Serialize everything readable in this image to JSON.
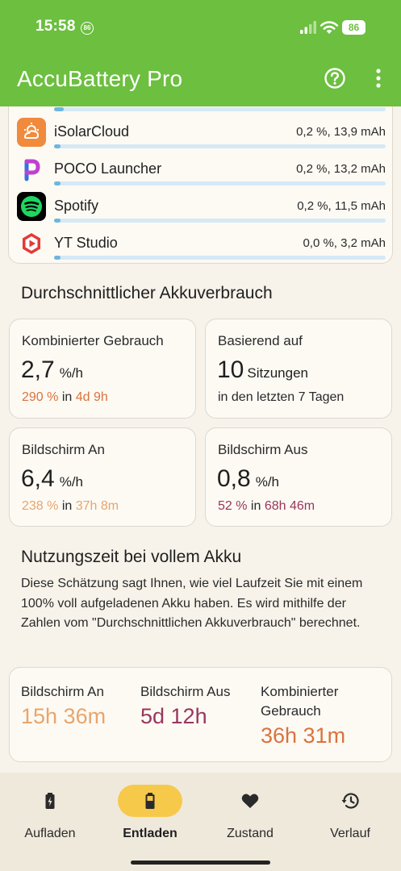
{
  "status_bar": {
    "time": "15:58",
    "notification_badge": "86",
    "battery_level": "86"
  },
  "app_bar": {
    "title": "AccuBattery Pro",
    "help_icon": "help-circle-icon",
    "more_icon": "more-vert-icon"
  },
  "app_usage": [
    {
      "name": "iSolarCloud",
      "value": "0,2 %, 13,9 mAh",
      "bar_fraction": 0.02,
      "icon": "isolarcloud-icon",
      "color": "#f08a3c"
    },
    {
      "name": "POCO Launcher",
      "value": "0,2 %, 13,2 mAh",
      "bar_fraction": 0.02,
      "icon": "poco-launcher-icon",
      "color": "#3b6fe0"
    },
    {
      "name": "Spotify",
      "value": "0,2 %, 11,5 mAh",
      "bar_fraction": 0.02,
      "icon": "spotify-icon",
      "color": "#1ed760"
    },
    {
      "name": "YT Studio",
      "value": "0,0 %, 3,2 mAh",
      "bar_fraction": 0.01,
      "icon": "yt-studio-icon",
      "color": "#e53935"
    }
  ],
  "average_usage": {
    "title": "Durchschnittlicher Akkuverbrauch",
    "combined": {
      "label": "Kombinierter Gebrauch",
      "value": "2,7",
      "unit": "%/h",
      "sub_value": "290 %",
      "sub_in": "in",
      "sub_time": "4d 9h"
    },
    "based_on": {
      "label": "Basierend auf",
      "value": "10",
      "unit": "Sitzungen",
      "sub_prefix": "in den letzten",
      "sub_count": "7",
      "sub_suffix": "Tagen"
    },
    "screen_on": {
      "label": "Bildschirm An",
      "value": "6,4",
      "unit": "%/h",
      "sub_value": "238 %",
      "sub_in": "in",
      "sub_time": "37h 8m"
    },
    "screen_off": {
      "label": "Bildschirm Aus",
      "value": "0,8",
      "unit": "%/h",
      "sub_value": "52 %",
      "sub_in": "in",
      "sub_time": "68h 46m"
    }
  },
  "full_charge": {
    "title": "Nutzungszeit bei vollem Akku",
    "description": "Diese Schätzung sagt Ihnen, wie viel Laufzeit Sie mit einem 100% voll aufgeladenen Akku haben. Es wird mithilfe der Zahlen vom \"Durchschnittlichen Akkuverbrauch\" berechnet.",
    "screen_on": {
      "label": "Bildschirm An",
      "value": "15h 36m"
    },
    "screen_off": {
      "label": "Bildschirm Aus",
      "value": "5d 12h"
    },
    "combined": {
      "label": "Kombinierter Gebrauch",
      "value": "36h 31m"
    }
  },
  "colors": {
    "accent_green": "#6cbf3f",
    "orange": "#d9733e",
    "peach": "#e8a56c",
    "plum": "#98365e",
    "active_pill": "#f7c94b"
  },
  "bottom_nav": [
    {
      "label": "Aufladen",
      "icon": "battery-charging-icon",
      "active": false
    },
    {
      "label": "Entladen",
      "icon": "battery-discharging-icon",
      "active": true
    },
    {
      "label": "Zustand",
      "icon": "heart-icon",
      "active": false
    },
    {
      "label": "Verlauf",
      "icon": "history-icon",
      "active": false
    }
  ]
}
